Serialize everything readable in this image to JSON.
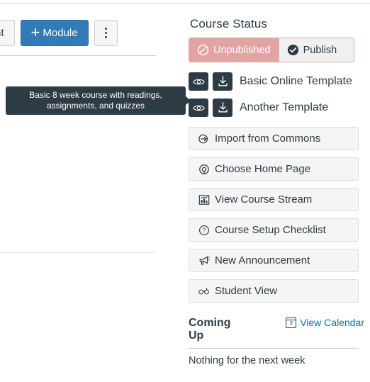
{
  "left": {
    "toolbar": {
      "content_button": "Content",
      "module_button": "Module",
      "kebab_label": "more-options"
    },
    "tooltip": {
      "text": "Basic 8 week course with readings, assignments, and quizzes"
    }
  },
  "right": {
    "course_status": {
      "title": "Course Status",
      "unpublished_label": "Unpublished",
      "publish_label": "Publish",
      "unpublished_color": "#e3a3a3",
      "publish_bg": "#f0f0f0"
    },
    "templates": [
      {
        "label": "Basic Online Template",
        "preview_icon": "eye-icon",
        "import_icon": "download-icon"
      },
      {
        "label": "Another Template",
        "preview_icon": "eye-icon",
        "import_icon": "download-icon"
      }
    ],
    "actions": [
      {
        "label": "Import from Commons",
        "icon": "commons-icon"
      },
      {
        "label": "Choose Home Page",
        "icon": "target-icon"
      },
      {
        "label": "View Course Stream",
        "icon": "bar-chart-icon"
      },
      {
        "label": "Course Setup Checklist",
        "icon": "question-circle-icon"
      },
      {
        "label": "New Announcement",
        "icon": "megaphone-icon"
      },
      {
        "label": "Student View",
        "icon": "glasses-icon"
      }
    ],
    "coming_up": {
      "title": "Coming Up",
      "view_calendar_label": "View Calendar",
      "calendar_day": "3",
      "empty_text": "Nothing for the next week",
      "link_color": "#0374b5"
    }
  }
}
